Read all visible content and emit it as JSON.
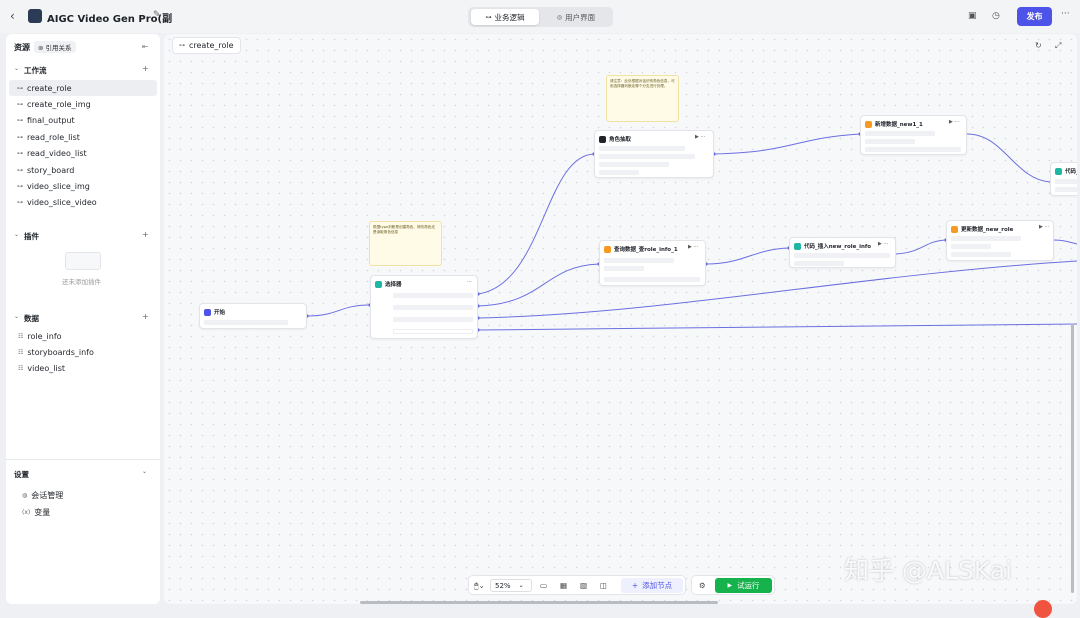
{
  "header": {
    "app_title": "AIGC Video Gen Pro(副",
    "tabs": [
      {
        "label": "业务逻辑",
        "icon": "flow-icon",
        "active": true
      },
      {
        "label": "用户界面",
        "icon": "palette-icon",
        "active": false
      }
    ],
    "publish_label": "发布",
    "accent": "#4d53e8"
  },
  "sidebar": {
    "resources_label": "资源",
    "references_tab": "引用关系",
    "workflow_section": "工作流",
    "workflows": [
      "create_role",
      "create_role_img",
      "final_output",
      "read_role_list",
      "read_video_list",
      "story_board",
      "video_slice_img",
      "video_slice_video"
    ],
    "selected_workflow": "create_role",
    "plugins_section": "插件",
    "plugins_empty": "还未添加插件",
    "data_section": "数据",
    "data_items": [
      "role_info",
      "storyboards_info",
      "video_list"
    ],
    "settings_section": "设置",
    "settings_items": [
      {
        "label": "会话管理",
        "icon": "session-icon"
      },
      {
        "label": "变量",
        "icon": "variable-icon"
      }
    ]
  },
  "canvas": {
    "breadcrumb": "create_role",
    "nodes": [
      {
        "id": "start",
        "title": "开始",
        "color": "#4d53e8"
      },
      {
        "id": "selector",
        "title": "选择器",
        "color": "#1fb6a4"
      },
      {
        "id": "role-extract",
        "title": "角色抽取",
        "color": "#1f2329"
      },
      {
        "id": "add-data",
        "title": "新增数据_new1_1",
        "color": "#f59a23"
      },
      {
        "id": "query-data",
        "title": "查询数据_查role_info_1",
        "color": "#f59a23"
      },
      {
        "id": "code-role",
        "title": "代码_插入new_role_info",
        "color": "#1fb6a4"
      },
      {
        "id": "update-data",
        "title": "更新数据_new_role",
        "color": "#f59a23"
      },
      {
        "id": "code-right",
        "title": "代码_",
        "color": "#1fb6a4"
      }
    ],
    "notes": [
      "请注意：此处根据对话识别角色信息，可用选择器判断走哪个分支进行处理。",
      "根据type判断是创建角色、修改角色还是读取角色信息"
    ],
    "edge_color": "#6b6fe0"
  },
  "bottom_toolbar": {
    "zoom": "52%",
    "add_node_label": "添加节点",
    "run_label": "试运行",
    "run_color": "#16b24b"
  },
  "watermark": "知乎 @ALSKai"
}
